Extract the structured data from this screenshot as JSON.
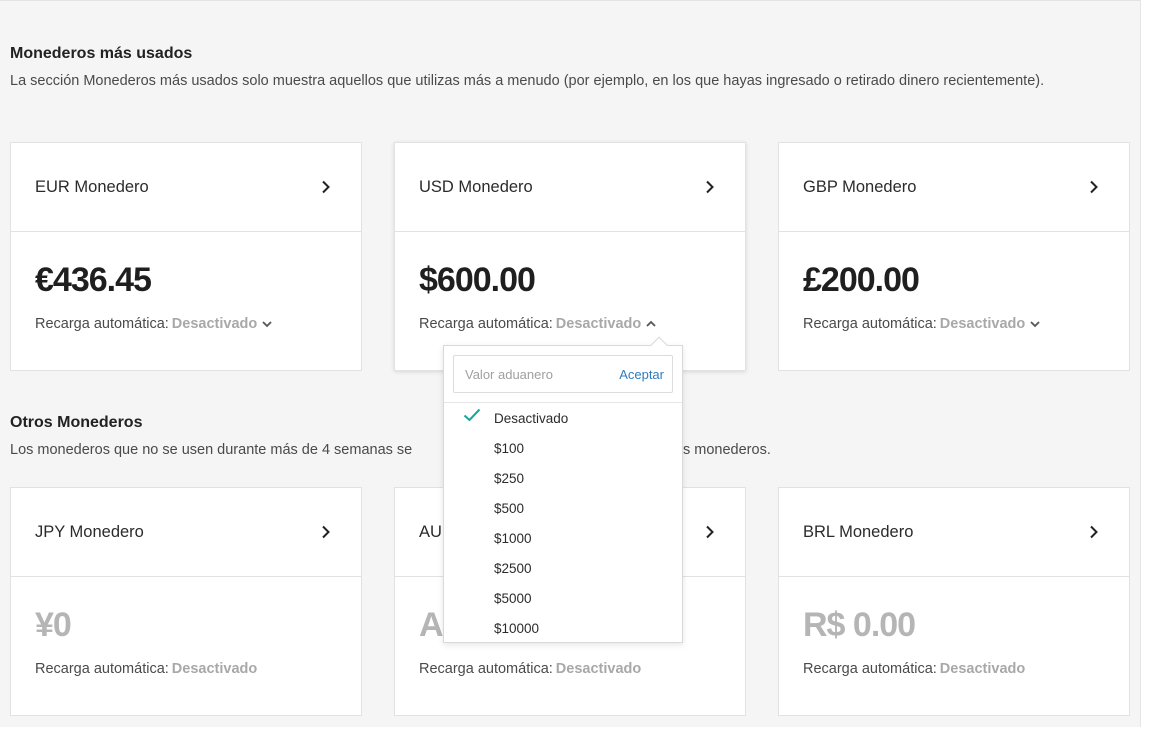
{
  "most_used": {
    "title": "Monederos más usados",
    "description": "La sección Monederos más usados solo muestra aquellos que utilizas más a menudo (por ejemplo, en los que hayas ingresado o retirado dinero recientemente).",
    "wallets": [
      {
        "name": "EUR Monedero",
        "balance": "€436.45",
        "recharge_label": "Recarga automática:",
        "recharge_value": "Desactivado"
      },
      {
        "name": "USD Monedero",
        "balance": "$600.00",
        "recharge_label": "Recarga automática:",
        "recharge_value": "Desactivado"
      },
      {
        "name": "GBP Monedero",
        "balance": "£200.00",
        "recharge_label": "Recarga automática:",
        "recharge_value": "Desactivado"
      }
    ]
  },
  "other": {
    "title": "Otros Monederos",
    "description": "Los monederos que no se usen durante más de 4 semanas se",
    "description_tail": "s monederos.",
    "wallets": [
      {
        "name": "JPY Monedero",
        "balance": "¥0",
        "recharge_label": "Recarga automática:",
        "recharge_value": "Desactivado"
      },
      {
        "name": "AU",
        "balance": "A",
        "recharge_label": "Recarga automática:",
        "recharge_value": "Desactivado"
      },
      {
        "name": "BRL Monedero",
        "balance": "R$ 0.00",
        "recharge_label": "Recarga automática:",
        "recharge_value": "Desactivado"
      }
    ]
  },
  "dropdown": {
    "custom_placeholder": "Valor aduanero",
    "accept_label": "Aceptar",
    "options": [
      "Desactivado",
      "$100",
      "$250",
      "$500",
      "$1000",
      "$2500",
      "$5000",
      "$10000"
    ],
    "selected": "Desactivado"
  },
  "colors": {
    "accent_link": "#2f7bbf",
    "check": "#1aa39a",
    "muted": "#a8a8a8"
  },
  "icons": {
    "card_arrow": "chevron-right-icon",
    "recharge_closed": "chevron-down-icon",
    "recharge_open": "chevron-up-icon",
    "selected_option": "check-icon"
  }
}
